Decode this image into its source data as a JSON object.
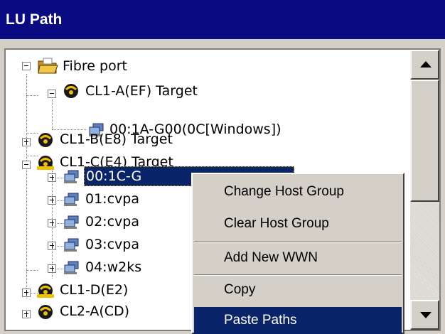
{
  "window": {
    "title": "LU Path"
  },
  "tree": {
    "root": {
      "label": "Fibre port"
    },
    "ports": [
      {
        "label": "CL1-A(EF) Target",
        "expanded": true,
        "children": [
          "00:1A-G00(0C[Windows])"
        ]
      },
      {
        "label": "CL1-B(E8) Target",
        "expanded": false
      },
      {
        "label": "CL1-C(E4) Target",
        "expanded": true,
        "children": [
          "00:1C-G",
          "01:cvpa",
          "02:cvpa",
          "03:cvpa",
          "04:w2ks"
        ]
      },
      {
        "label": "CL1-D(E2) ",
        "expanded": false
      },
      {
        "label": "CL2-A(CD)",
        "expanded": false
      }
    ],
    "selected": "00:1C-G"
  },
  "context_menu": {
    "items": [
      {
        "label": "Change Host Group"
      },
      {
        "label": "Clear Host Group"
      },
      {
        "label": "Add New WWN"
      },
      {
        "label": "Copy"
      },
      {
        "label": "Paste Paths",
        "highlighted": true
      }
    ]
  },
  "colors": {
    "title_bg": "#0a0a82",
    "selection": "#0a246a",
    "face": "#d4d0c8"
  }
}
